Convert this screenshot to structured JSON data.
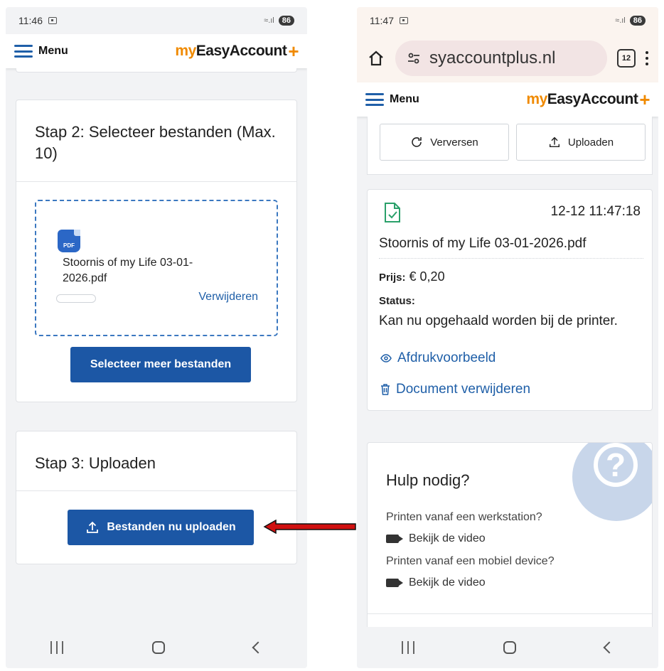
{
  "left": {
    "status": {
      "time": "11:46",
      "battery": "86"
    },
    "nav": {
      "menu": "Menu",
      "logo_my": "my",
      "logo_rest": "EasyAccount",
      "logo_plus": "+"
    },
    "step2": {
      "title": "Stap 2: Selecteer bestanden (Max. 10)",
      "pdf_badge": "PDF",
      "file_name": "Stoornis of my Life 03-01-2026.pdf",
      "remove": "Verwijderen",
      "select_more": "Selecteer meer bestanden"
    },
    "step3": {
      "title": "Stap 3: Uploaden",
      "upload_button": "Bestanden nu uploaden"
    }
  },
  "right": {
    "status": {
      "time": "11:47",
      "battery": "86"
    },
    "browser": {
      "url": "syaccountplus.nl",
      "tabs": "12"
    },
    "nav": {
      "menu": "Menu",
      "logo_my": "my",
      "logo_rest": "EasyAccount",
      "logo_plus": "+"
    },
    "toolbar": {
      "refresh": "Verversen",
      "upload": "Uploaden"
    },
    "document": {
      "timestamp": "12-12 11:47:18",
      "file_name": "Stoornis of my Life 03-01-2026.pdf",
      "price_label": "Prijs:",
      "price_value": "€ 0,20",
      "status_label": "Status:",
      "status_value": "Kan nu opgehaald worden bij de printer.",
      "preview_link": "Afdrukvoorbeeld",
      "delete_link": "Document verwijderen"
    },
    "help": {
      "title": "Hulp nodig?",
      "q1": "Printen vanaf een werkstation?",
      "video1": "Bekijk de video",
      "q2": "Printen vanaf een mobiel device?",
      "video2": "Bekijk de video"
    }
  },
  "colors": {
    "brand_blue": "#1c57a5",
    "brand_orange": "#f08a00",
    "arrow_red": "#d01010"
  }
}
